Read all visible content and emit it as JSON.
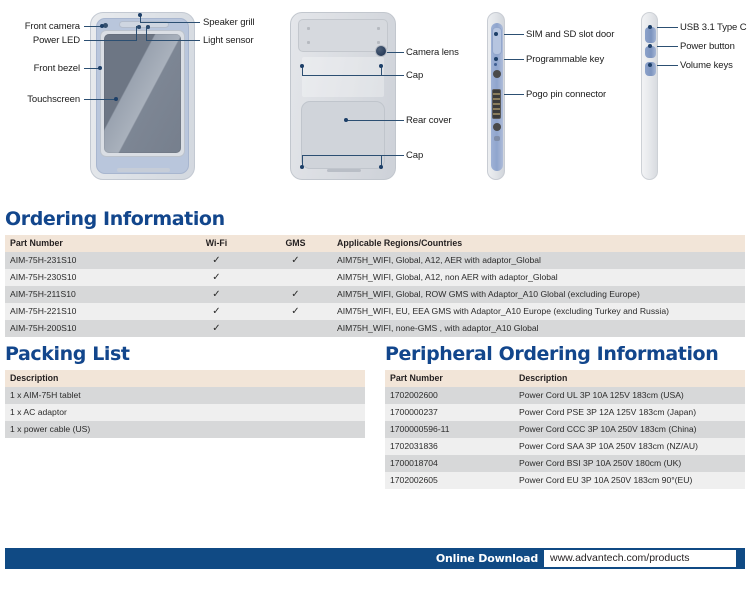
{
  "diagram": {
    "front_view": {
      "labels_left": [
        {
          "text": "Front camera"
        },
        {
          "text": "Power LED"
        },
        {
          "text": "Front bezel"
        },
        {
          "text": "Touchscreen"
        }
      ],
      "labels_right": [
        {
          "text": "Speaker grill"
        },
        {
          "text": "Light sensor"
        }
      ]
    },
    "rear_view": {
      "labels_right": [
        {
          "text": "Camera lens"
        },
        {
          "text": "Cap"
        },
        {
          "text": "Rear cover"
        },
        {
          "text": "Cap"
        }
      ]
    },
    "left_side_view": {
      "labels_right": [
        {
          "text": "SIM and SD slot door"
        },
        {
          "text": "Programmable key"
        },
        {
          "text": "Pogo pin connector"
        }
      ]
    },
    "right_side_view": {
      "labels_right": [
        {
          "text": "USB 3.1 Type C"
        },
        {
          "text": "Power button"
        },
        {
          "text": "Volume keys"
        }
      ]
    }
  },
  "ordering": {
    "title": "Ordering Information",
    "headers": [
      "Part Number",
      "Wi-Fi",
      "GMS",
      "Applicable Regions/Countries"
    ],
    "check": "✓",
    "rows": [
      {
        "part": "AIM-75H-231S10",
        "wifi": "✓",
        "gms": "✓",
        "regions": "AIM75H_WIFI, Global, A12, AER with adaptor_Global"
      },
      {
        "part": "AIM-75H-230S10",
        "wifi": "✓",
        "gms": "",
        "regions": "AIM75H_WIFI, Global, A12, non AER with adaptor_Global"
      },
      {
        "part": "AIM-75H-211S10",
        "wifi": "✓",
        "gms": "✓",
        "regions": "AIM75H_WIFI, Global, ROW GMS with Adaptor_A10 Global (excluding Europe)"
      },
      {
        "part": "AIM-75H-221S10",
        "wifi": "✓",
        "gms": "✓",
        "regions": "AIM75H_WIFI, EU, EEA GMS with Adaptor_A10 Europe (excluding Turkey and Russia)"
      },
      {
        "part": "AIM-75H-200S10",
        "wifi": "✓",
        "gms": "",
        "regions": "AIM75H_WIFI, none-GMS , with adaptor_A10 Global"
      }
    ]
  },
  "packing": {
    "title": "Packing List",
    "headers": [
      "Description"
    ],
    "rows": [
      {
        "description": "1 x AIM-75H tablet"
      },
      {
        "description": "1 x AC adaptor"
      },
      {
        "description": "1 x power cable (US)"
      }
    ]
  },
  "peripheral": {
    "title": "Peripheral Ordering Information",
    "headers": [
      "Part Number",
      "Description"
    ],
    "rows": [
      {
        "part": "1702002600",
        "description": "Power Cord UL 3P 10A 125V 183cm (USA)"
      },
      {
        "part": "1700000237",
        "description": "Power Cord PSE 3P 12A 125V 183cm (Japan)"
      },
      {
        "part": "1700000596-11",
        "description": "Power Cord CCC 3P 10A 250V 183cm (China)"
      },
      {
        "part": "1702031836",
        "description": "Power Cord SAA 3P 10A 250V 183cm (NZ/AU)"
      },
      {
        "part": "1700018704",
        "description": "Power Cord BSI 3P 10A 250V 180cm (UK)"
      },
      {
        "part": "1702002605",
        "description": "Power Cord EU 3P 10A 250V 183cm 90°(EU)"
      }
    ]
  },
  "footer": {
    "download_label": "Online Download",
    "download_url": "www.advantech.com/products"
  },
  "colors": {
    "heading_blue": "#12468c",
    "footer_blue": "#104a84",
    "table_header_beige": "#f2e5d8",
    "row_dark": "#d7d8d9",
    "row_light": "#efefef",
    "leader_blue": "#2c4f72"
  }
}
